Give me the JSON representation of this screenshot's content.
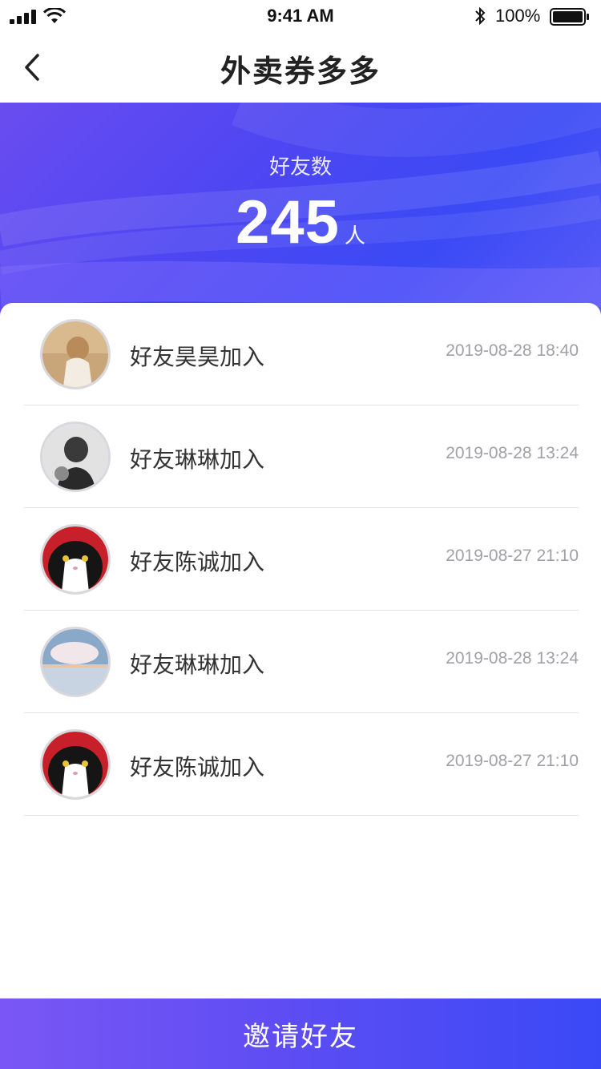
{
  "status_bar": {
    "time": "9:41 AM",
    "battery_text": "100%",
    "icons": [
      "signal-icon",
      "wifi-icon",
      "bluetooth-icon",
      "battery-icon"
    ]
  },
  "nav": {
    "title": "外卖券多多",
    "back_icon": "chevron-left-icon"
  },
  "banner": {
    "label": "好友数",
    "count": "245",
    "unit": "人"
  },
  "friends": [
    {
      "name": "好友昊昊加入",
      "time": "2019-08-28 18:40",
      "avatar": "girl-photo"
    },
    {
      "name": "好友琳琳加入",
      "time": "2019-08-28 13:24",
      "avatar": "man-bw-photo"
    },
    {
      "name": "好友陈诚加入",
      "time": "2019-08-27 21:10",
      "avatar": "cat-photo"
    },
    {
      "name": "好友琳琳加入",
      "time": "2019-08-28 13:24",
      "avatar": "sky-photo"
    },
    {
      "name": "好友陈诚加入",
      "time": "2019-08-27 21:10",
      "avatar": "cat-photo"
    }
  ],
  "invite_button": {
    "label": "邀请好友"
  },
  "colors": {
    "accent_start": "#7a57f5",
    "accent_end": "#3a49f6",
    "time_text": "#a0a0a6"
  }
}
